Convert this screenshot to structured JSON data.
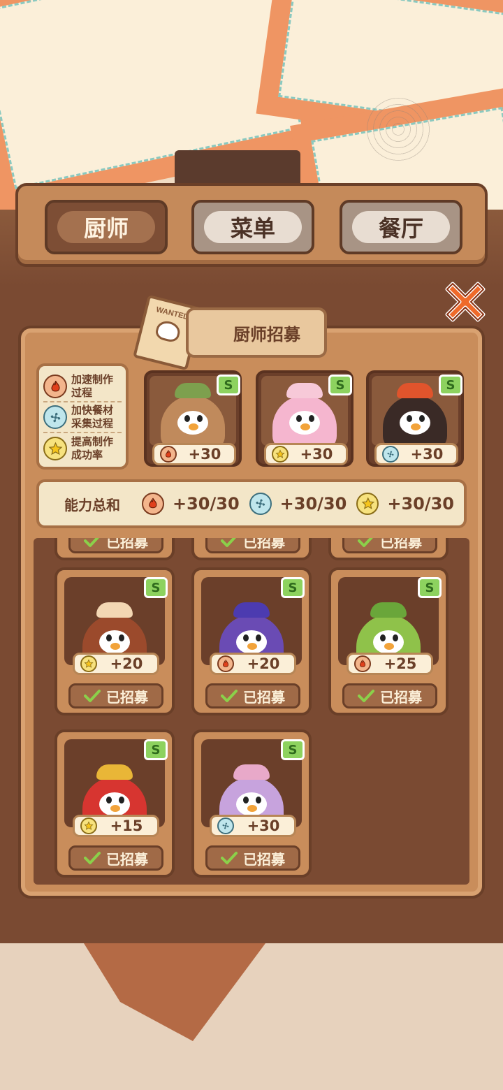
{
  "tabs": [
    {
      "label": "厨师",
      "active": true
    },
    {
      "label": "菜单",
      "active": false
    },
    {
      "label": "餐厅",
      "active": false
    }
  ],
  "panel_title": "厨师招募",
  "poster_text": "WANTED",
  "legend": [
    {
      "icon": "fire-icon",
      "text": "加速制作\n过程"
    },
    {
      "icon": "fan-icon",
      "text": "加快餐材\n采集过程"
    },
    {
      "icon": "star-icon",
      "text": "提高制作\n成功率"
    }
  ],
  "selected_slots": [
    {
      "rank": "S",
      "stat_icon": "fire-icon",
      "value": "+30",
      "body_color": "#c08a5c",
      "hat_color": "#7da04e"
    },
    {
      "rank": "S",
      "stat_icon": "star-icon",
      "value": "+30",
      "body_color": "#f5b6cf",
      "hat_color": "#f7c9d8"
    },
    {
      "rank": "S",
      "stat_icon": "fan-icon",
      "value": "+30",
      "body_color": "#3a2a26",
      "hat_color": "#e0542c"
    }
  ],
  "summary": {
    "label": "能力总和",
    "fire": "+30/30",
    "fan": "+30/30",
    "star": "+30/30"
  },
  "recruited_label": "已招募",
  "chefs": [
    {
      "rank": "S",
      "stat_icon": "star-icon",
      "value": "+20",
      "body_color": "#9b4a2c",
      "hat_color": "#f3d7b3"
    },
    {
      "rank": "S",
      "stat_icon": "fire-icon",
      "value": "+20",
      "body_color": "#6a4bb4",
      "hat_color": "#4c3bb0"
    },
    {
      "rank": "S",
      "stat_icon": "fire-icon",
      "value": "+25",
      "body_color": "#8fc24a",
      "hat_color": "#6aa63a"
    },
    {
      "rank": "S",
      "stat_icon": "star-icon",
      "value": "+15",
      "body_color": "#d73530",
      "hat_color": "#e9b637"
    },
    {
      "rank": "S",
      "stat_icon": "fan-icon",
      "value": "+30",
      "body_color": "#c7a3dd",
      "hat_color": "#e8a9c9"
    }
  ],
  "colors": {
    "rank_badge": "#8dd25f",
    "panel": "#c98d5b",
    "wood_dark": "#6a3f28",
    "close": "#ef6a2a"
  }
}
